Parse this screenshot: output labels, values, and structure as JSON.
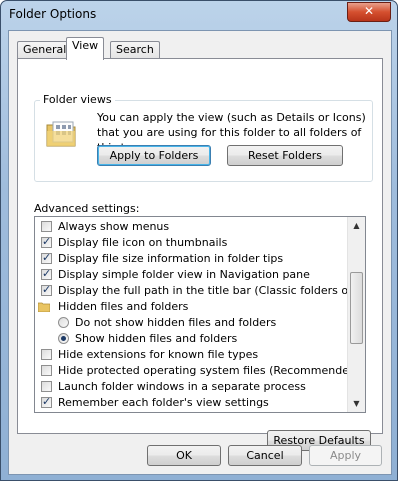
{
  "window": {
    "title": "Folder Options",
    "close_glyph": "✕"
  },
  "tabs": [
    {
      "label": "General"
    },
    {
      "label": "View"
    },
    {
      "label": "Search"
    }
  ],
  "folder_views": {
    "group_label": "Folder views",
    "description": "You can apply the view (such as Details or Icons) that you are using for this folder to all folders of this type.",
    "apply_button": "Apply to Folders",
    "reset_button": "Reset Folders",
    "icon": "folder-views-icon"
  },
  "advanced": {
    "label": "Advanced settings:",
    "items": [
      {
        "type": "checkbox",
        "label": "Always show menus",
        "checked": false,
        "indent": 0
      },
      {
        "type": "checkbox",
        "label": "Display file icon on thumbnails",
        "checked": true,
        "indent": 0
      },
      {
        "type": "checkbox",
        "label": "Display file size information in folder tips",
        "checked": true,
        "indent": 0
      },
      {
        "type": "checkbox",
        "label": "Display simple folder view in Navigation pane",
        "checked": true,
        "indent": 0
      },
      {
        "type": "checkbox",
        "label": "Display the full path in the title bar (Classic folders only)",
        "checked": true,
        "indent": 0
      },
      {
        "type": "folder",
        "label": "Hidden files and folders",
        "checked": false,
        "indent": 0
      },
      {
        "type": "radio",
        "label": "Do not show hidden files and folders",
        "checked": false,
        "indent": 1
      },
      {
        "type": "radio",
        "label": "Show hidden files and folders",
        "checked": true,
        "indent": 1
      },
      {
        "type": "checkbox",
        "label": "Hide extensions for known file types",
        "checked": false,
        "indent": 0
      },
      {
        "type": "checkbox",
        "label": "Hide protected operating system files (Recommended)",
        "checked": false,
        "indent": 0
      },
      {
        "type": "checkbox",
        "label": "Launch folder windows in a separate process",
        "checked": false,
        "indent": 0
      },
      {
        "type": "checkbox",
        "label": "Remember each folder's view settings",
        "checked": true,
        "indent": 0
      }
    ],
    "restore_button": "Restore Defaults"
  },
  "footer": {
    "ok": "OK",
    "cancel": "Cancel",
    "apply": "Apply"
  },
  "scroll": {
    "up_glyph": "▲",
    "down_glyph": "▼"
  }
}
